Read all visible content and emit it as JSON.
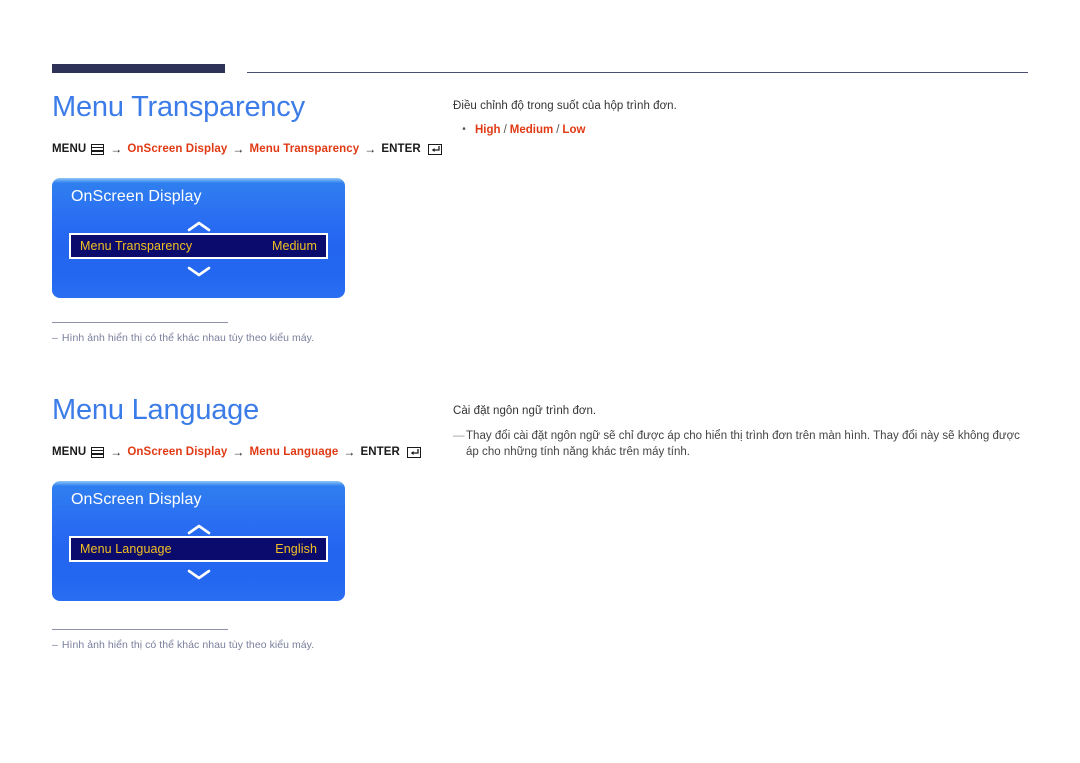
{
  "header": {
    "bar_color": "#2e3258",
    "rule_color": "#4b4f75"
  },
  "sections": [
    {
      "id": "transparency",
      "title": "Menu Transparency",
      "menu_path": {
        "menu_label": "MENU",
        "menu_icon": "menu-grid-icon",
        "arrow": "→",
        "step1": "OnScreen Display",
        "step2": "Menu Transparency",
        "enter_label": "ENTER",
        "enter_icon": "enter-return-icon"
      },
      "osd": {
        "title": "OnScreen Display",
        "up_icon": "chevron-up-icon",
        "down_icon": "chevron-down-icon",
        "row_label": "Menu Transparency",
        "row_value": "Medium"
      },
      "footnote": "Hình ảnh hiển thị có thể khác nhau tùy theo kiểu máy.",
      "footnote_dash": "–",
      "description": "Điều chỉnh độ trong suốt của hộp trình đơn.",
      "options": [
        "High",
        "Medium",
        "Low"
      ],
      "option_separator": "/",
      "option_bullet": "•"
    },
    {
      "id": "language",
      "title": "Menu Language",
      "menu_path": {
        "menu_label": "MENU",
        "menu_icon": "menu-grid-icon",
        "arrow": "→",
        "step1": "OnScreen Display",
        "step2": "Menu Language",
        "enter_label": "ENTER",
        "enter_icon": "enter-return-icon"
      },
      "osd": {
        "title": "OnScreen Display",
        "up_icon": "chevron-up-icon",
        "down_icon": "chevron-down-icon",
        "row_label": "Menu Language",
        "row_value": "English"
      },
      "footnote": "Hình ảnh hiển thị có thể khác nhau tùy theo kiểu máy.",
      "footnote_dash": "–",
      "description": "Cài đặt ngôn ngữ trình đơn.",
      "note_dash": "—",
      "note": "Thay đổi cài đặt ngôn ngữ sẽ chỉ được áp cho hiển thị trình đơn trên màn hình. Thay đổi này sẽ không được áp cho những tính năng khác trên máy tính."
    }
  ],
  "colors": {
    "title_blue": "#3c7ce8",
    "accent_red": "#e03a14",
    "osd_highlight_bg": "#0b0b6e",
    "osd_text_gold": "#f2c021",
    "footnote_gray": "#7a7f9c"
  }
}
